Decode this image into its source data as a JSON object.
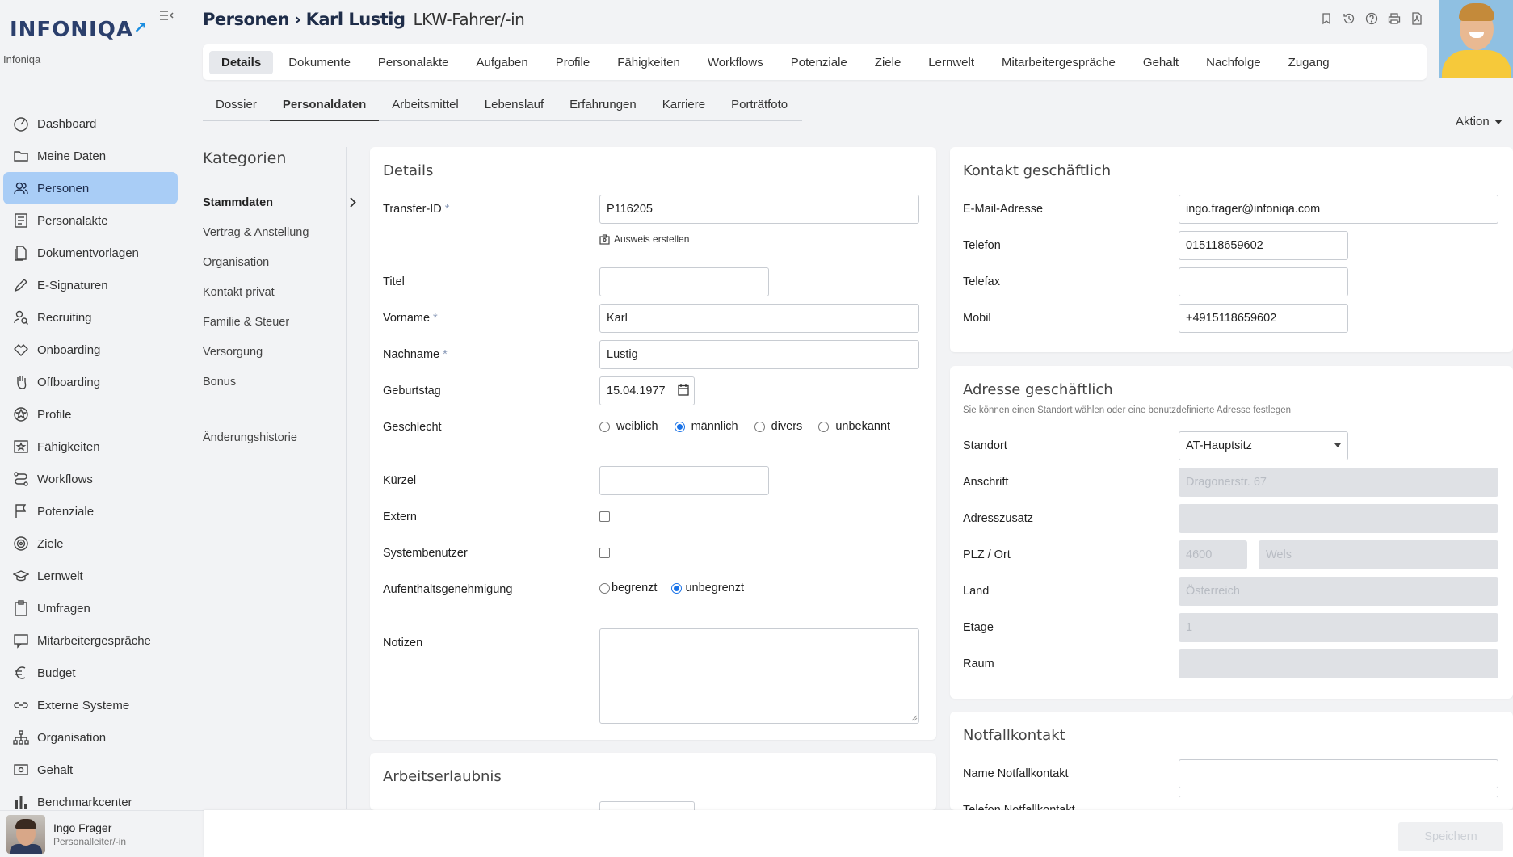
{
  "brand": {
    "logo": "INFONIQA",
    "sub": "Infoniqa"
  },
  "sidebar": {
    "items": [
      {
        "label": "Dashboard",
        "icon": "dashboard-icon"
      },
      {
        "label": "Meine Daten",
        "icon": "folder-icon"
      },
      {
        "label": "Personen",
        "icon": "people-icon",
        "active": true
      },
      {
        "label": "Personalakte",
        "icon": "file-list-icon"
      },
      {
        "label": "Dokumentvorlagen",
        "icon": "document-icon"
      },
      {
        "label": "E-Signaturen",
        "icon": "pen-icon"
      },
      {
        "label": "Recruiting",
        "icon": "recruiting-icon"
      },
      {
        "label": "Onboarding",
        "icon": "handshake-icon"
      },
      {
        "label": "Offboarding",
        "icon": "hand-icon"
      },
      {
        "label": "Profile",
        "icon": "profile-star-icon"
      },
      {
        "label": "Fähigkeiten",
        "icon": "star-board-icon"
      },
      {
        "label": "Workflows",
        "icon": "workflow-icon"
      },
      {
        "label": "Potenziale",
        "icon": "flag-icon"
      },
      {
        "label": "Ziele",
        "icon": "target-icon"
      },
      {
        "label": "Lernwelt",
        "icon": "graduation-icon"
      },
      {
        "label": "Umfragen",
        "icon": "clipboard-icon"
      },
      {
        "label": "Mitarbeitergespräche",
        "icon": "chat-icon"
      },
      {
        "label": "Budget",
        "icon": "euro-icon"
      },
      {
        "label": "Externe Systeme",
        "icon": "link-icon"
      },
      {
        "label": "Organisation",
        "icon": "org-chart-icon"
      },
      {
        "label": "Gehalt",
        "icon": "salary-icon"
      },
      {
        "label": "Benchmarkcenter",
        "icon": "bar-chart-icon"
      }
    ]
  },
  "user": {
    "name": "Ingo Frager",
    "role": "Personalleiter/-in"
  },
  "header": {
    "breadcrumb": "Personen",
    "separator": "›",
    "person": "Karl Lustig",
    "job": "LKW-Fahrer/-in"
  },
  "main_tabs": [
    "Details",
    "Dokumente",
    "Personalakte",
    "Aufgaben",
    "Profile",
    "Fähigkeiten",
    "Workflows",
    "Potenziale",
    "Ziele",
    "Lernwelt",
    "Mitarbeitergespräche",
    "Gehalt",
    "Nachfolge",
    "Zugang"
  ],
  "sub_tabs": [
    "Dossier",
    "Personaldaten",
    "Arbeitsmittel",
    "Lebenslauf",
    "Erfahrungen",
    "Karriere",
    "Porträtfoto"
  ],
  "aktion": "Aktion",
  "kategorien": {
    "title": "Kategorien",
    "items": [
      "Stammdaten",
      "Vertrag & Anstellung",
      "Organisation",
      "Kontakt privat",
      "Familie & Steuer",
      "Versorgung",
      "Bonus"
    ],
    "history": "Änderungshistorie"
  },
  "details": {
    "title": "Details",
    "transfer_id_label": "Transfer-ID",
    "transfer_id": "P116205",
    "ausweis": "Ausweis erstellen",
    "titel_label": "Titel",
    "titel": "",
    "vorname_label": "Vorname",
    "vorname": "Karl",
    "nachname_label": "Nachname",
    "nachname": "Lustig",
    "geburtstag_label": "Geburtstag",
    "geburtstag": "15.04.1977",
    "geschlecht_label": "Geschlecht",
    "geschlecht_options": [
      "weiblich",
      "männlich",
      "divers",
      "unbekannt"
    ],
    "geschlecht_selected": "männlich",
    "kuerzel_label": "Kürzel",
    "extern_label": "Extern",
    "systembenutzer_label": "Systembenutzer",
    "aufenthalt_label": "Aufenthaltsgenehmigung",
    "aufenthalt_options": [
      "begrenzt",
      "unbegrenzt"
    ],
    "aufenthalt_selected": "unbegrenzt",
    "notizen_label": "Notizen",
    "required_mark": "*"
  },
  "arbeitserlaubnis": {
    "title": "Arbeitserlaubnis"
  },
  "kontakt": {
    "title": "Kontakt geschäftlich",
    "email_label": "E-Mail-Adresse",
    "email": "ingo.frager@infoniqa.com",
    "telefon_label": "Telefon",
    "telefon": "015118659602",
    "telefax_label": "Telefax",
    "telefax": "",
    "mobil_label": "Mobil",
    "mobil": "+4915118659602"
  },
  "adresse": {
    "title": "Adresse geschäftlich",
    "subtitle": "Sie können einen Standort wählen oder eine benutzdefinierte Adresse festlegen",
    "standort_label": "Standort",
    "standort": "AT-Hauptsitz",
    "anschrift_label": "Anschrift",
    "anschrift": "Dragonerstr. 67",
    "adresszusatz_label": "Adresszusatz",
    "plz_ort_label": "PLZ / Ort",
    "plz": "4600",
    "ort": "Wels",
    "land_label": "Land",
    "land": "Österreich",
    "etage_label": "Etage",
    "etage": "1",
    "raum_label": "Raum"
  },
  "notfall": {
    "title": "Notfallkontakt",
    "name_label": "Name Notfallkontakt",
    "telefon_label": "Telefon Notfallkontakt"
  },
  "footer": {
    "save": "Speichern"
  },
  "colors": {
    "accent": "#1a73e8",
    "active_nav": "#a9cdf6",
    "logo": "#2b3f6c"
  }
}
